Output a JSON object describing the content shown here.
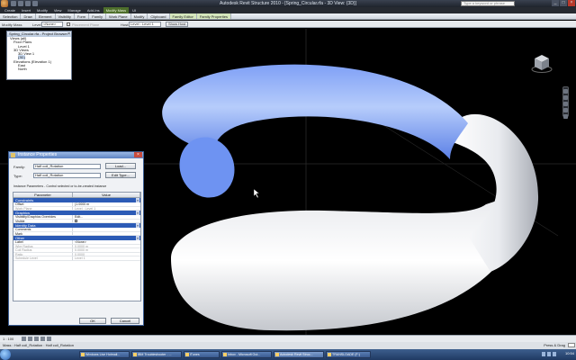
{
  "window": {
    "title": "Autodesk Revit Structure 2010 - [Spring_Circular.rfa - 3D View: {3D}]",
    "search_placeholder": "Type a keyword or phrase",
    "controls": [
      "_",
      "□",
      "×"
    ]
  },
  "ribbon": {
    "tabs": [
      "Create",
      "Insert",
      "Modify",
      "View",
      "Manage",
      "Add-Ins",
      "Modify Mass",
      "UI"
    ],
    "active_tab": "Modify Mass",
    "panels": [
      "Selection",
      "Draw",
      "Element",
      "Visibility",
      "Form",
      "Family",
      "Work Plane",
      "Modify",
      "Clipboard",
      "Family Editor",
      "Family Properties"
    ]
  },
  "options_bar": {
    "mode": "Modify Mass",
    "level_label": "Level:",
    "level_value": "<None>",
    "placement_plane_label": "Placement Plane",
    "host_label": "Host:",
    "host_value": "Level : Level 1",
    "show_host": "Show Host"
  },
  "project_browser": {
    "title": "Spring_Circular.rfa - Project Browser",
    "close": "×",
    "items": [
      {
        "level": 1,
        "text": "Views (all)"
      },
      {
        "level": 2,
        "text": "Floor Plans"
      },
      {
        "level": 3,
        "text": "Level 1"
      },
      {
        "level": 2,
        "text": "3D Views"
      },
      {
        "level": 3,
        "text": "3D View 1"
      },
      {
        "level": 3,
        "text": "{3D}",
        "selected": true
      },
      {
        "level": 2,
        "text": "Elevations (Elevation 1)"
      },
      {
        "level": 3,
        "text": "East"
      },
      {
        "level": 3,
        "text": "North"
      }
    ]
  },
  "properties": {
    "title": "Instance Properties",
    "close": "×",
    "family_label": "Family:",
    "family_value": "Half coil_Rotation",
    "type_label": "Type:",
    "type_value": "Half coil_Rotation",
    "load_button": "Load...",
    "edit_type_button": "Edit Type...",
    "instance_params_label": "Instance Parameters - Control selected or to-be-created instance",
    "col_parameter": "Parameter",
    "col_value": "Value",
    "groups": [
      {
        "name": "Constraints",
        "rows": [
          {
            "p": "Offset",
            "v": "(1.0000 m",
            "dim": false
          },
          {
            "p": "Work Plane",
            "v": "Level : Level 1",
            "dim": true
          }
        ]
      },
      {
        "name": "Graphics",
        "rows": [
          {
            "p": "Visibility/Graphics Overrides",
            "v": "Edit...",
            "dim": false
          },
          {
            "p": "Visible",
            "v": "",
            "check": true,
            "dim": false
          }
        ]
      },
      {
        "name": "Identity Data",
        "rows": [
          {
            "p": "Comments",
            "v": "",
            "dim": false
          },
          {
            "p": "Mark",
            "v": "",
            "dim": false
          }
        ]
      },
      {
        "name": "Other",
        "rows": [
          {
            "p": "Label",
            "v": "<None>",
            "dim": false
          },
          {
            "p": "Wire Radius",
            "v": "0.0000 m",
            "dim": true
          },
          {
            "p": "Coil Radius",
            "v": "0.0000 m",
            "dim": true
          },
          {
            "p": "Ratio",
            "v": "0.0000",
            "dim": true
          },
          {
            "p": "Schedule Level",
            "v": "Level 1",
            "dim": true
          }
        ]
      }
    ],
    "ok_button": "OK",
    "cancel_button": "Cancel"
  },
  "view_bar": {
    "scale": "1 : 100"
  },
  "status_bar": {
    "text": "Mass : Half coil_Rotation : Half coil_Rotation",
    "right_text": "Press & Drag"
  },
  "taskbar": {
    "tasks": [
      "Windows Live Hotmail...",
      "IBM Troubleshooter - ...",
      "iTunes",
      "Inbox - Microsoft Out...",
      "Autodesk Revit Struc...",
      "TRANSLOADE (F:)"
    ],
    "active_task": "Autodesk Revit Struc...",
    "clock": "10:54"
  },
  "colors": {
    "selected_solid": "#6e93f2",
    "solid": "#e8eaee",
    "viewport_bg": "#000000",
    "ribbon_context": "#4e6e2c",
    "param_group": "#2c5bb6"
  }
}
